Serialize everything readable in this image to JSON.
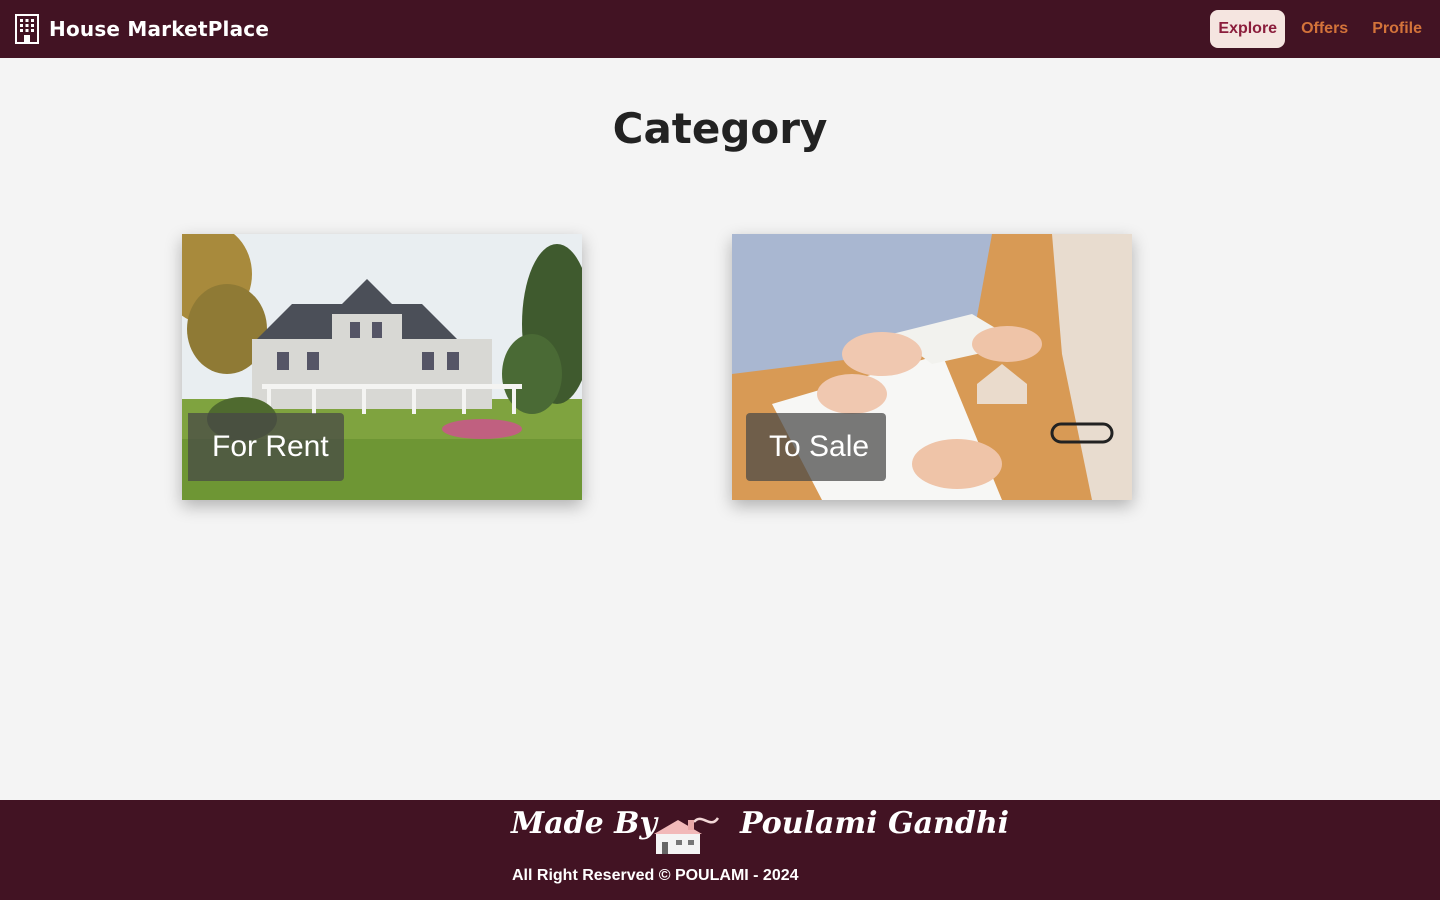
{
  "navbar": {
    "brand_title": "House MarketPlace",
    "brand_icon": "building-icon",
    "links": [
      {
        "label": "Explore",
        "active": true
      },
      {
        "label": "Offers",
        "active": false
      },
      {
        "label": "Profile",
        "active": false
      }
    ]
  },
  "main": {
    "title": "Category",
    "categories": [
      {
        "label": "For Rent",
        "image": "white-house-with-lawn-photo"
      },
      {
        "label": "To Sale",
        "image": "handing-over-house-keys-photo"
      }
    ]
  },
  "footer": {
    "made_by": "Made By",
    "author": "Poulami Gandhi",
    "icon": "house-chimney-icon",
    "copyright": "All Right Reserved © POULAMI - 2024"
  },
  "colors": {
    "navbar_bg": "#421323",
    "accent": "#d3733a",
    "active_link_text": "#8b1d3c",
    "active_link_bg": "#f5e5e0",
    "page_bg": "#f4f4f4"
  }
}
